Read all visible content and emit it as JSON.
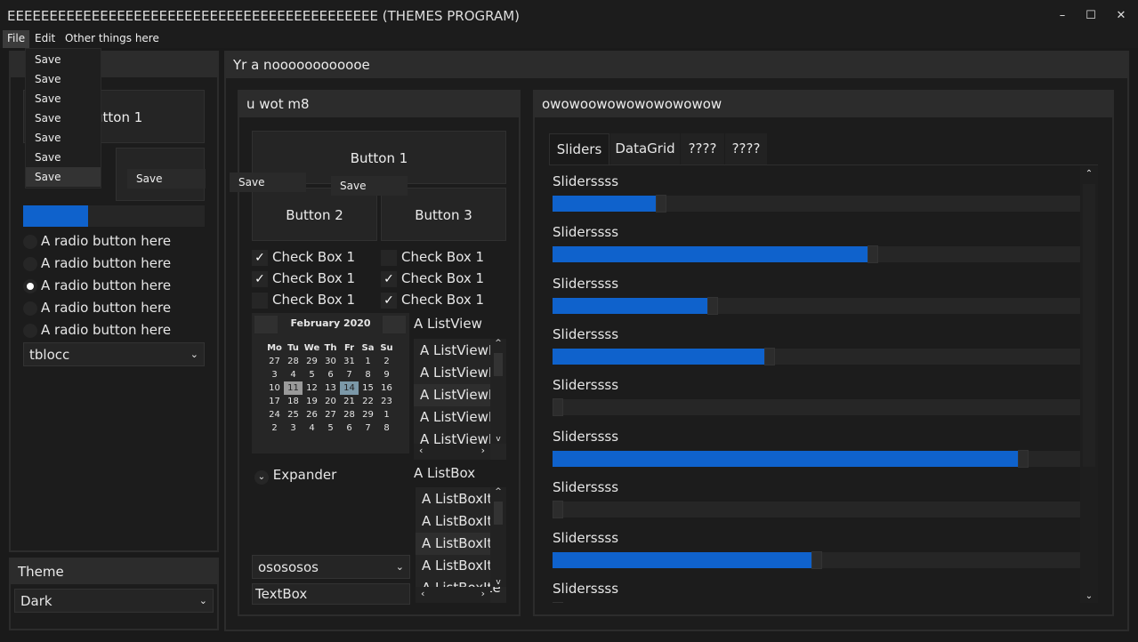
{
  "window": {
    "title": "EEEEEEEEEEEEEEEEEEEEEEEEEEEEEEEEEEEEEEEEEEEE (THEMES PROGRAM)",
    "minimize": "–",
    "maximize": "☐",
    "close": "✕"
  },
  "menu": {
    "items": [
      "File",
      "Edit",
      "Other things here"
    ],
    "file_items": [
      "Save",
      "Save",
      "Save",
      "Save",
      "Save",
      "Save",
      "Save"
    ],
    "submenu_items": [
      "Save",
      "Save",
      "Save"
    ]
  },
  "left": {
    "button1": "Button 1",
    "progress": 0.36,
    "radios": [
      "A radio button here",
      "A radio button here",
      "A radio button here",
      "A radio button here",
      "A radio button here"
    ],
    "radio_selected": 2,
    "combo": "tblocc",
    "theme_header": "Theme",
    "theme_value": "Dark"
  },
  "main": {
    "header": "Yr a noooooooooooe"
  },
  "mid": {
    "header": "u wot m8",
    "buttons": [
      "Button 1",
      "Button 2",
      "Button 3"
    ],
    "checkboxes": [
      {
        "label": "Check Box 1",
        "checked": true
      },
      {
        "label": "Check Box 1",
        "checked": false
      },
      {
        "label": "Check Box 1",
        "checked": true
      },
      {
        "label": "Check Box 1",
        "checked": true
      },
      {
        "label": "Check Box 1",
        "checked": false
      },
      {
        "label": "Check Box 1",
        "checked": true
      }
    ],
    "calendar": {
      "month": "February 2020",
      "days": [
        "Mo",
        "Tu",
        "We",
        "Th",
        "Fr",
        "Sa",
        "Su"
      ],
      "weeks": [
        [
          "27",
          "28",
          "29",
          "30",
          "31",
          "1",
          "2"
        ],
        [
          "3",
          "4",
          "5",
          "6",
          "7",
          "8",
          "9"
        ],
        [
          "10",
          "11",
          "12",
          "13",
          "14",
          "15",
          "16"
        ],
        [
          "17",
          "18",
          "19",
          "20",
          "21",
          "22",
          "23"
        ],
        [
          "24",
          "25",
          "26",
          "27",
          "28",
          "29",
          "1"
        ],
        [
          "2",
          "3",
          "4",
          "5",
          "6",
          "7",
          "8"
        ]
      ],
      "selected": "11",
      "today": "14"
    },
    "listview_label": "A ListView",
    "listview_items": [
      "A ListViewIt",
      "A ListViewIt",
      "A ListViewIt",
      "A ListViewIt",
      "A ListViewIt"
    ],
    "expander": "Expander",
    "listbox_label": "A ListBox",
    "listbox_items": [
      "A ListBoxIte",
      "A ListBoxIte",
      "A ListBoxIte",
      "A ListBoxIte",
      "A ListBoxIte"
    ],
    "combo": "osososos",
    "textbox": "TextBox"
  },
  "right": {
    "header": "owowoowowowowowowow",
    "tabs": [
      "Sliders",
      "DataGrid",
      "????",
      "????"
    ],
    "slider_label": "Sliderssss",
    "sliders": [
      0.2,
      0.61,
      0.3,
      0.41,
      0.0,
      0.9,
      0.0,
      0.5,
      0.0
    ]
  },
  "colors": {
    "accent": "#0f62cc",
    "background": "#1a1a1a",
    "panel": "#2c2c2c"
  }
}
